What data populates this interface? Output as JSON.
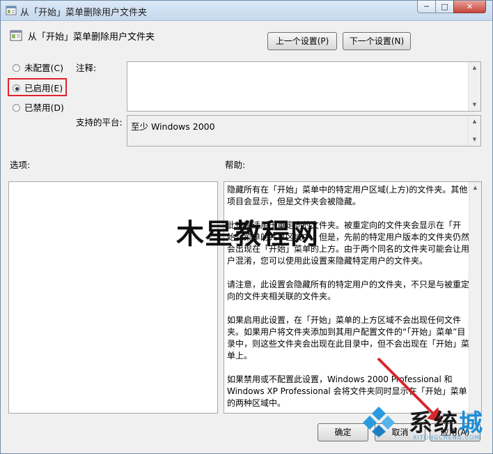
{
  "window": {
    "title": "从「开始」菜单删除用户文件夹",
    "controls": {
      "minimize": "─",
      "maximize": "□",
      "close": "✕"
    }
  },
  "policy": {
    "name": "从「开始」菜单删除用户文件夹"
  },
  "nav": {
    "prev_label": "上一个设置(P)",
    "next_label": "下一个设置(N)"
  },
  "state": {
    "options": [
      {
        "label": "未配置(C)",
        "selected": false
      },
      {
        "label": "已启用(E)",
        "selected": true
      },
      {
        "label": "已禁用(D)",
        "selected": false
      }
    ]
  },
  "comment": {
    "label": "注释:",
    "value": ""
  },
  "platform": {
    "label": "支持的平台:",
    "value": "至少 Windows 2000"
  },
  "options_panel": {
    "label": "选项:"
  },
  "help_panel": {
    "label": "帮助:",
    "paragraphs": [
      "隐藏所有在「开始」菜单中的特定用户区域(上方)的文件夹。其他项目会显示，但是文件夹会被隐藏。",
      "此设置适用于重定向的文件夹。被重定向的文件夹会显示在「开始」菜单的共享区域中。但是，先前的特定用户版本的文件夹仍然会出现在「开始」菜单的上方。由于两个同名的文件夹可能会让用户混淆，您可以使用此设置来隐藏特定用户的文件夹。",
      "请注意，此设置会隐藏所有的特定用户的文件夹，不只是与被重定向的文件夹相关联的文件夹。",
      "如果启用此设置，在「开始」菜单的上方区域不会出现任何文件夹。如果用户将文件夹添加到其用户配置文件的“「开始」菜单”目录中，则这些文件夹会出现在此目录中，但不会出现在「开始」菜单上。",
      "如果禁用或不配置此设置，Windows 2000 Professional 和 Windows XP Professional 会将文件夹同时显示在「开始」菜单的两种区域中。"
    ]
  },
  "footer": {
    "ok_label": "确定",
    "cancel_label": "取消",
    "apply_label": "应用(A)"
  },
  "watermark": {
    "text": "木星教程网"
  },
  "logo": {
    "text_part1": "系统",
    "text_part2": "城",
    "subtext": "XITONGCHENG.COM"
  },
  "colors": {
    "highlight_border": "#e0232c",
    "logo_blue": "#1e8ed6",
    "arrow_red": "#d8262a"
  }
}
